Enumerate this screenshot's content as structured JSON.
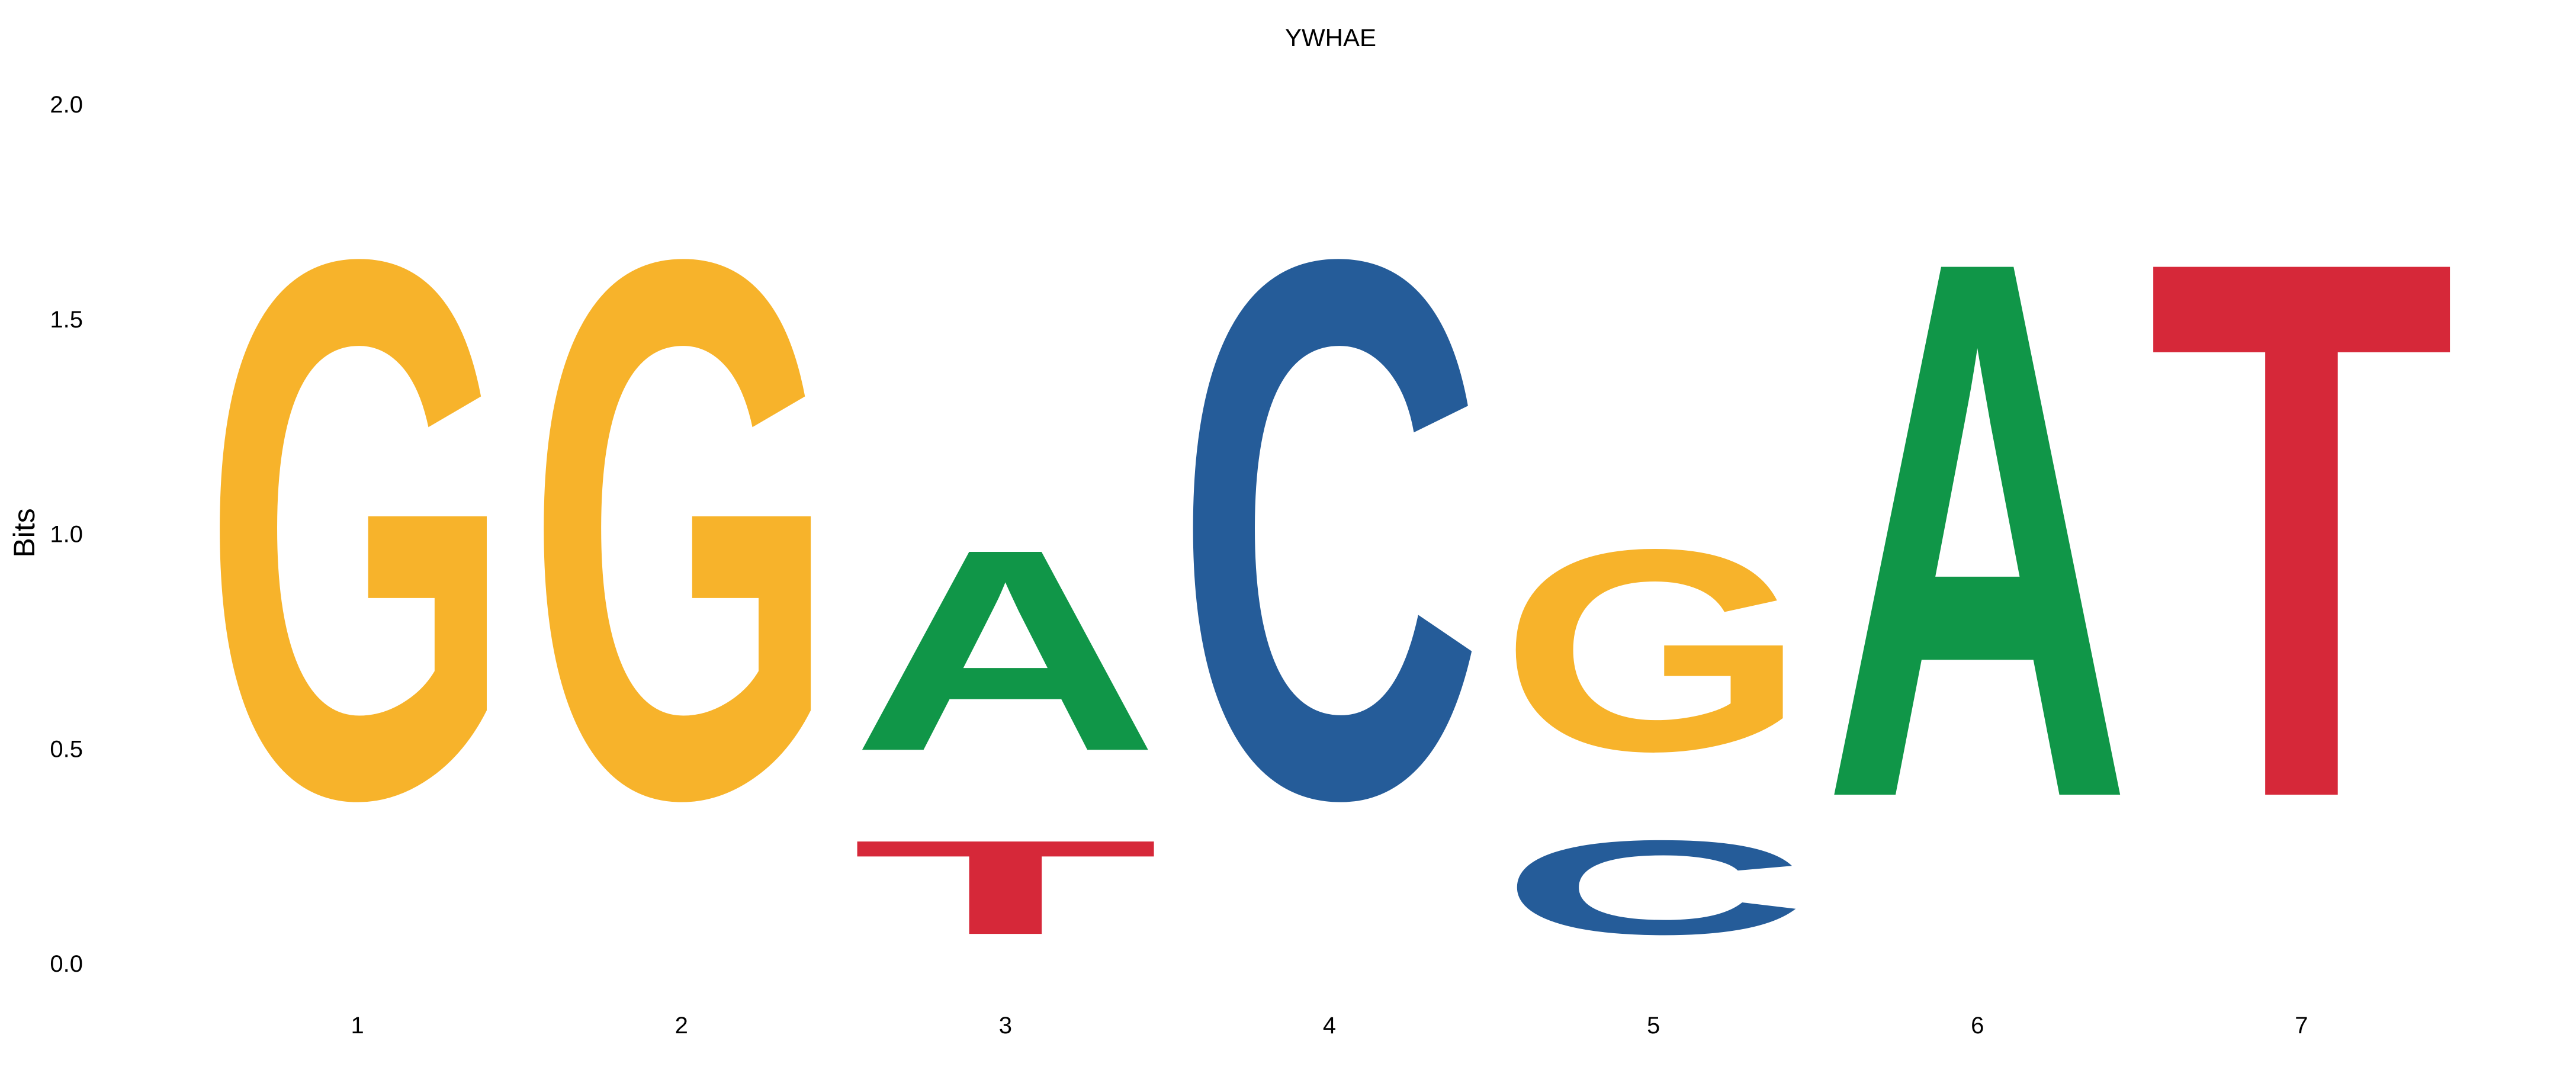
{
  "chart_data": {
    "type": "sequence-logo",
    "title": "YWHAE",
    "ylabel": "Bits",
    "xlabel": "",
    "ylim": [
      0,
      2
    ],
    "yticks": [
      "0.0",
      "0.5",
      "1.0",
      "1.5",
      "2.0"
    ],
    "positions": [
      "1",
      "2",
      "3",
      "4",
      "5",
      "6",
      "7"
    ],
    "colors": {
      "A": "#109648",
      "C": "#255C99",
      "G": "#F7B32B",
      "T": "#D62839"
    },
    "stacks": [
      [
        {
          "letter": "G",
          "bits": 2.0
        }
      ],
      [
        {
          "letter": "G",
          "bits": 2.0
        }
      ],
      [
        {
          "letter": "T",
          "bits": 0.35
        },
        {
          "letter": "A",
          "bits": 0.75
        }
      ],
      [
        {
          "letter": "C",
          "bits": 2.0
        }
      ],
      [
        {
          "letter": "C",
          "bits": 0.35
        },
        {
          "letter": "G",
          "bits": 0.75
        }
      ],
      [
        {
          "letter": "A",
          "bits": 2.0
        }
      ],
      [
        {
          "letter": "T",
          "bits": 2.0
        }
      ]
    ],
    "grid": false,
    "legend": "none"
  }
}
